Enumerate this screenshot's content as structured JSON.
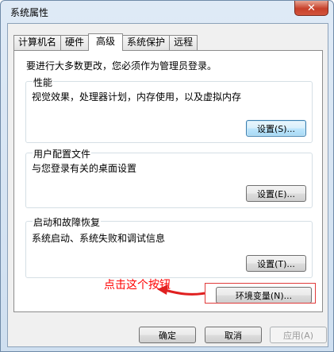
{
  "window": {
    "title": "系统属性",
    "close_label": "✕"
  },
  "tabs": [
    {
      "label": "计算机名",
      "active": false
    },
    {
      "label": "硬件",
      "active": false
    },
    {
      "label": "高级",
      "active": true
    },
    {
      "label": "系统保护",
      "active": false
    },
    {
      "label": "远程",
      "active": false
    }
  ],
  "panel": {
    "notice": "要进行大多数更改，您必须作为管理员登录。",
    "performance": {
      "title": "性能",
      "desc": "视觉效果，处理器计划，内存使用，以及虚拟内存",
      "button": "设置(S)..."
    },
    "profile": {
      "title": "用户配置文件",
      "desc": "与您登录有关的桌面设置",
      "button": "设置(E)..."
    },
    "startup": {
      "title": "启动和故障恢复",
      "desc": "系统启动、系统失败和调试信息",
      "button": "设置(T)..."
    },
    "env_button": "环境变量(N)..."
  },
  "annotation": {
    "text": "点击这个按钮",
    "color": "#ff0000"
  },
  "footer": {
    "ok": "确定",
    "cancel": "取消",
    "apply": "应用(A)"
  }
}
